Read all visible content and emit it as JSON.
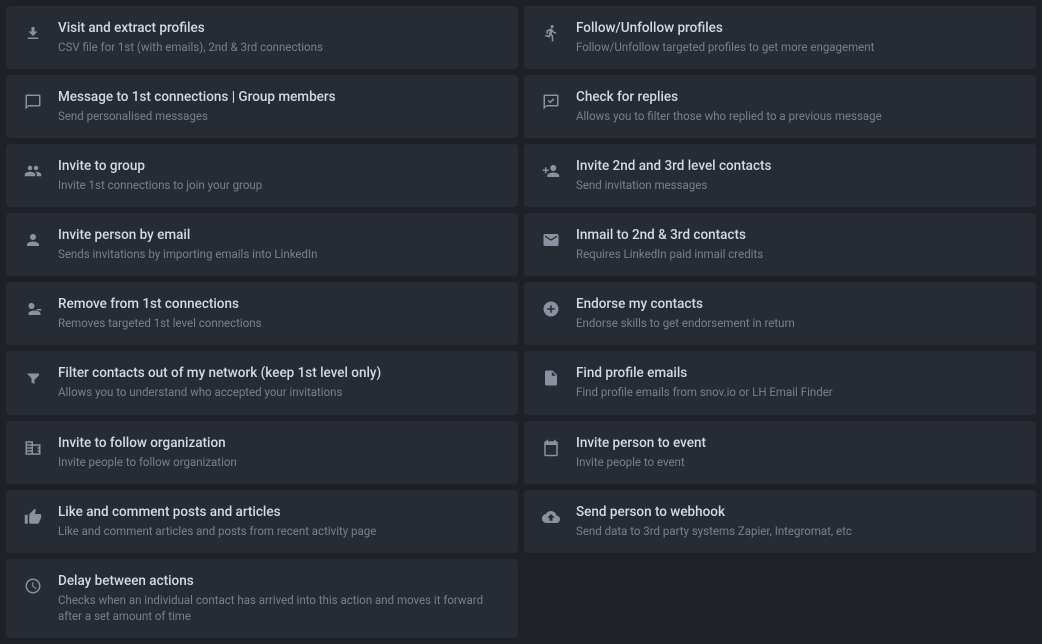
{
  "cards": [
    {
      "id": "visit-extract",
      "title": "Visit and extract profiles",
      "desc": "CSV file for 1st (with emails), 2nd & 3rd connections",
      "icon": "download",
      "col": 0
    },
    {
      "id": "follow-unfollow",
      "title": "Follow/Unfollow profiles",
      "desc": "Follow/Unfollow targeted profiles to get more engagement",
      "icon": "person-walk",
      "col": 1
    },
    {
      "id": "message-1st",
      "title": "Message to 1st connections | Group members",
      "desc": "Send personalised messages",
      "icon": "chat",
      "col": 0
    },
    {
      "id": "check-replies",
      "title": "Check for replies",
      "desc": "Allows you to filter those who replied to a previous message",
      "icon": "chat-check",
      "col": 1
    },
    {
      "id": "invite-group",
      "title": "Invite to group",
      "desc": "Invite 1st connections to join your group",
      "icon": "people",
      "col": 0
    },
    {
      "id": "invite-2nd-3rd",
      "title": "Invite 2nd and 3rd level contacts",
      "desc": "Send invitation messages",
      "icon": "person-add",
      "col": 1
    },
    {
      "id": "invite-email",
      "title": "Invite person by email",
      "desc": "Sends invitations by importing emails into LinkedIn",
      "icon": "person-plus",
      "col": 0
    },
    {
      "id": "inmail-2nd-3rd",
      "title": "Inmail to 2nd & 3rd contacts",
      "desc": "Requires LinkedIn paid inmail credits",
      "icon": "envelope",
      "col": 1
    },
    {
      "id": "remove-connections",
      "title": "Remove from 1st connections",
      "desc": "Removes targeted 1st level connections",
      "icon": "person-minus",
      "col": 0
    },
    {
      "id": "endorse-contacts",
      "title": "Endorse my contacts",
      "desc": "Endorse skills to get endorsement in return",
      "icon": "plus-circle",
      "col": 1
    },
    {
      "id": "filter-contacts",
      "title": "Filter contacts out of my network (keep 1st level only)",
      "desc": "Allows you to understand who accepted your invitations",
      "icon": "filter",
      "col": 0
    },
    {
      "id": "find-emails",
      "title": "Find profile emails",
      "desc": "Find profile emails from snov.io or LH Email Finder",
      "icon": "search-file",
      "col": 1
    },
    {
      "id": "invite-follow-org",
      "title": "Invite to follow organization",
      "desc": "Invite people to follow organization",
      "icon": "building",
      "col": 0
    },
    {
      "id": "invite-event",
      "title": "Invite person to event",
      "desc": "Invite people to event",
      "icon": "calendar",
      "col": 1
    },
    {
      "id": "like-comment",
      "title": "Like and comment posts and articles",
      "desc": "Like and comment articles and posts from recent activity page",
      "icon": "thumb-up",
      "col": 0
    },
    {
      "id": "send-webhook",
      "title": "Send person to webhook",
      "desc": "Send data to 3rd party systems Zapier, Integromat, etc",
      "icon": "cloud",
      "col": 1
    },
    {
      "id": "delay-actions",
      "title": "Delay between actions",
      "desc": "Checks when an individual contact has arrived into this action and moves it forward after a set amount of time",
      "icon": "clock",
      "col": 0
    }
  ]
}
